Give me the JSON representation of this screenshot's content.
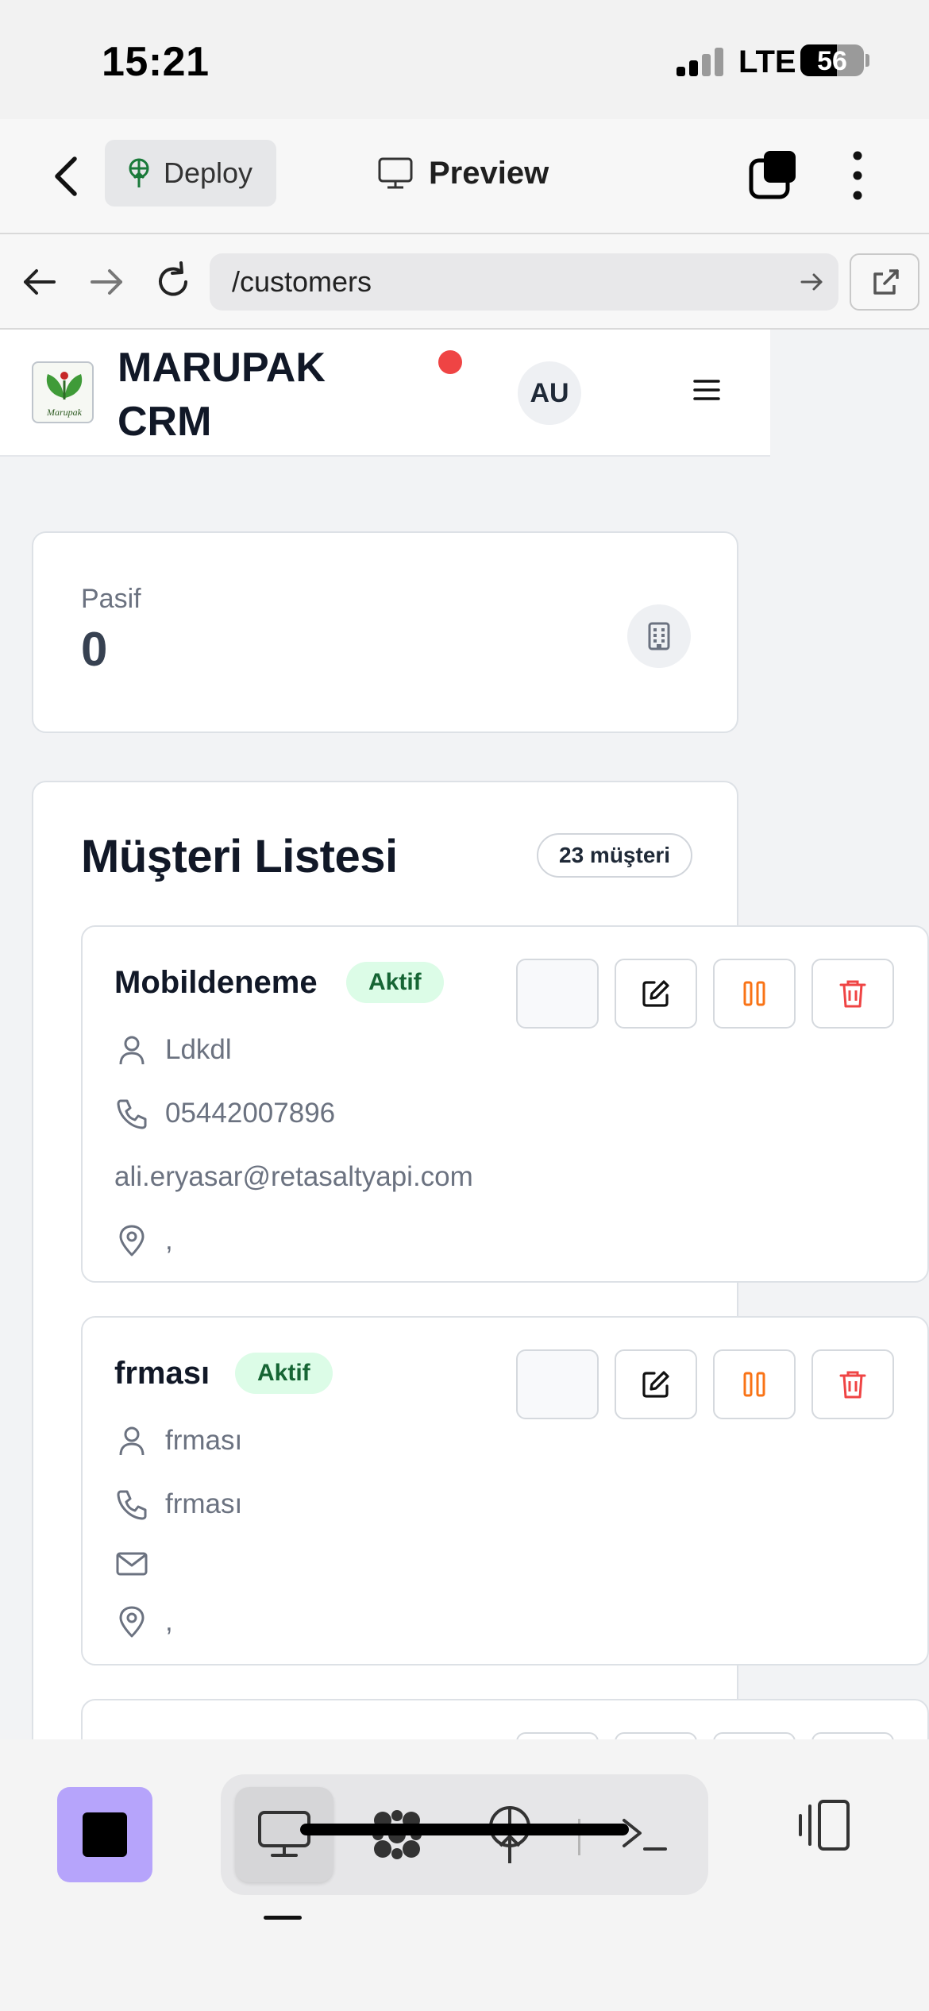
{
  "status_bar": {
    "time": "15:21",
    "network": "LTE",
    "battery": "56"
  },
  "app_bar": {
    "deploy_label": "Deploy",
    "preview_label": "Preview"
  },
  "browser": {
    "url": "/customers"
  },
  "crm": {
    "brand_line1": "MARUPAK",
    "brand_line2": "CRM",
    "logo_text": "Marupak",
    "avatar_initials": "AU"
  },
  "stats": {
    "pasif": {
      "label": "Pasif",
      "value": "0"
    }
  },
  "customer_list": {
    "title": "Müşteri Listesi",
    "count_label": "23 müşteri",
    "customers": [
      {
        "name": "Mobildeneme",
        "status": "Aktif",
        "contact_person": "Ldkdl",
        "phone": "05442007896",
        "email": "ali.eryasar@retasaltyapi.com",
        "address": ","
      },
      {
        "name": "frması",
        "status": "Aktif",
        "contact_person": "frması",
        "phone": "frması",
        "email": "",
        "address": ","
      }
    ]
  },
  "colors": {
    "accent_purple": "#b6a4fb",
    "status_green_bg": "#dcfce7",
    "status_green_text": "#166534",
    "pause_orange": "#f97316",
    "delete_red": "#ef4444",
    "notification_red": "#ef4444"
  },
  "icons": {
    "toolbar": [
      "monitor-icon",
      "apps-grid-icon",
      "deploy-antenna-icon",
      "terminal-icon"
    ],
    "panel": "panel-toggle-icon"
  }
}
